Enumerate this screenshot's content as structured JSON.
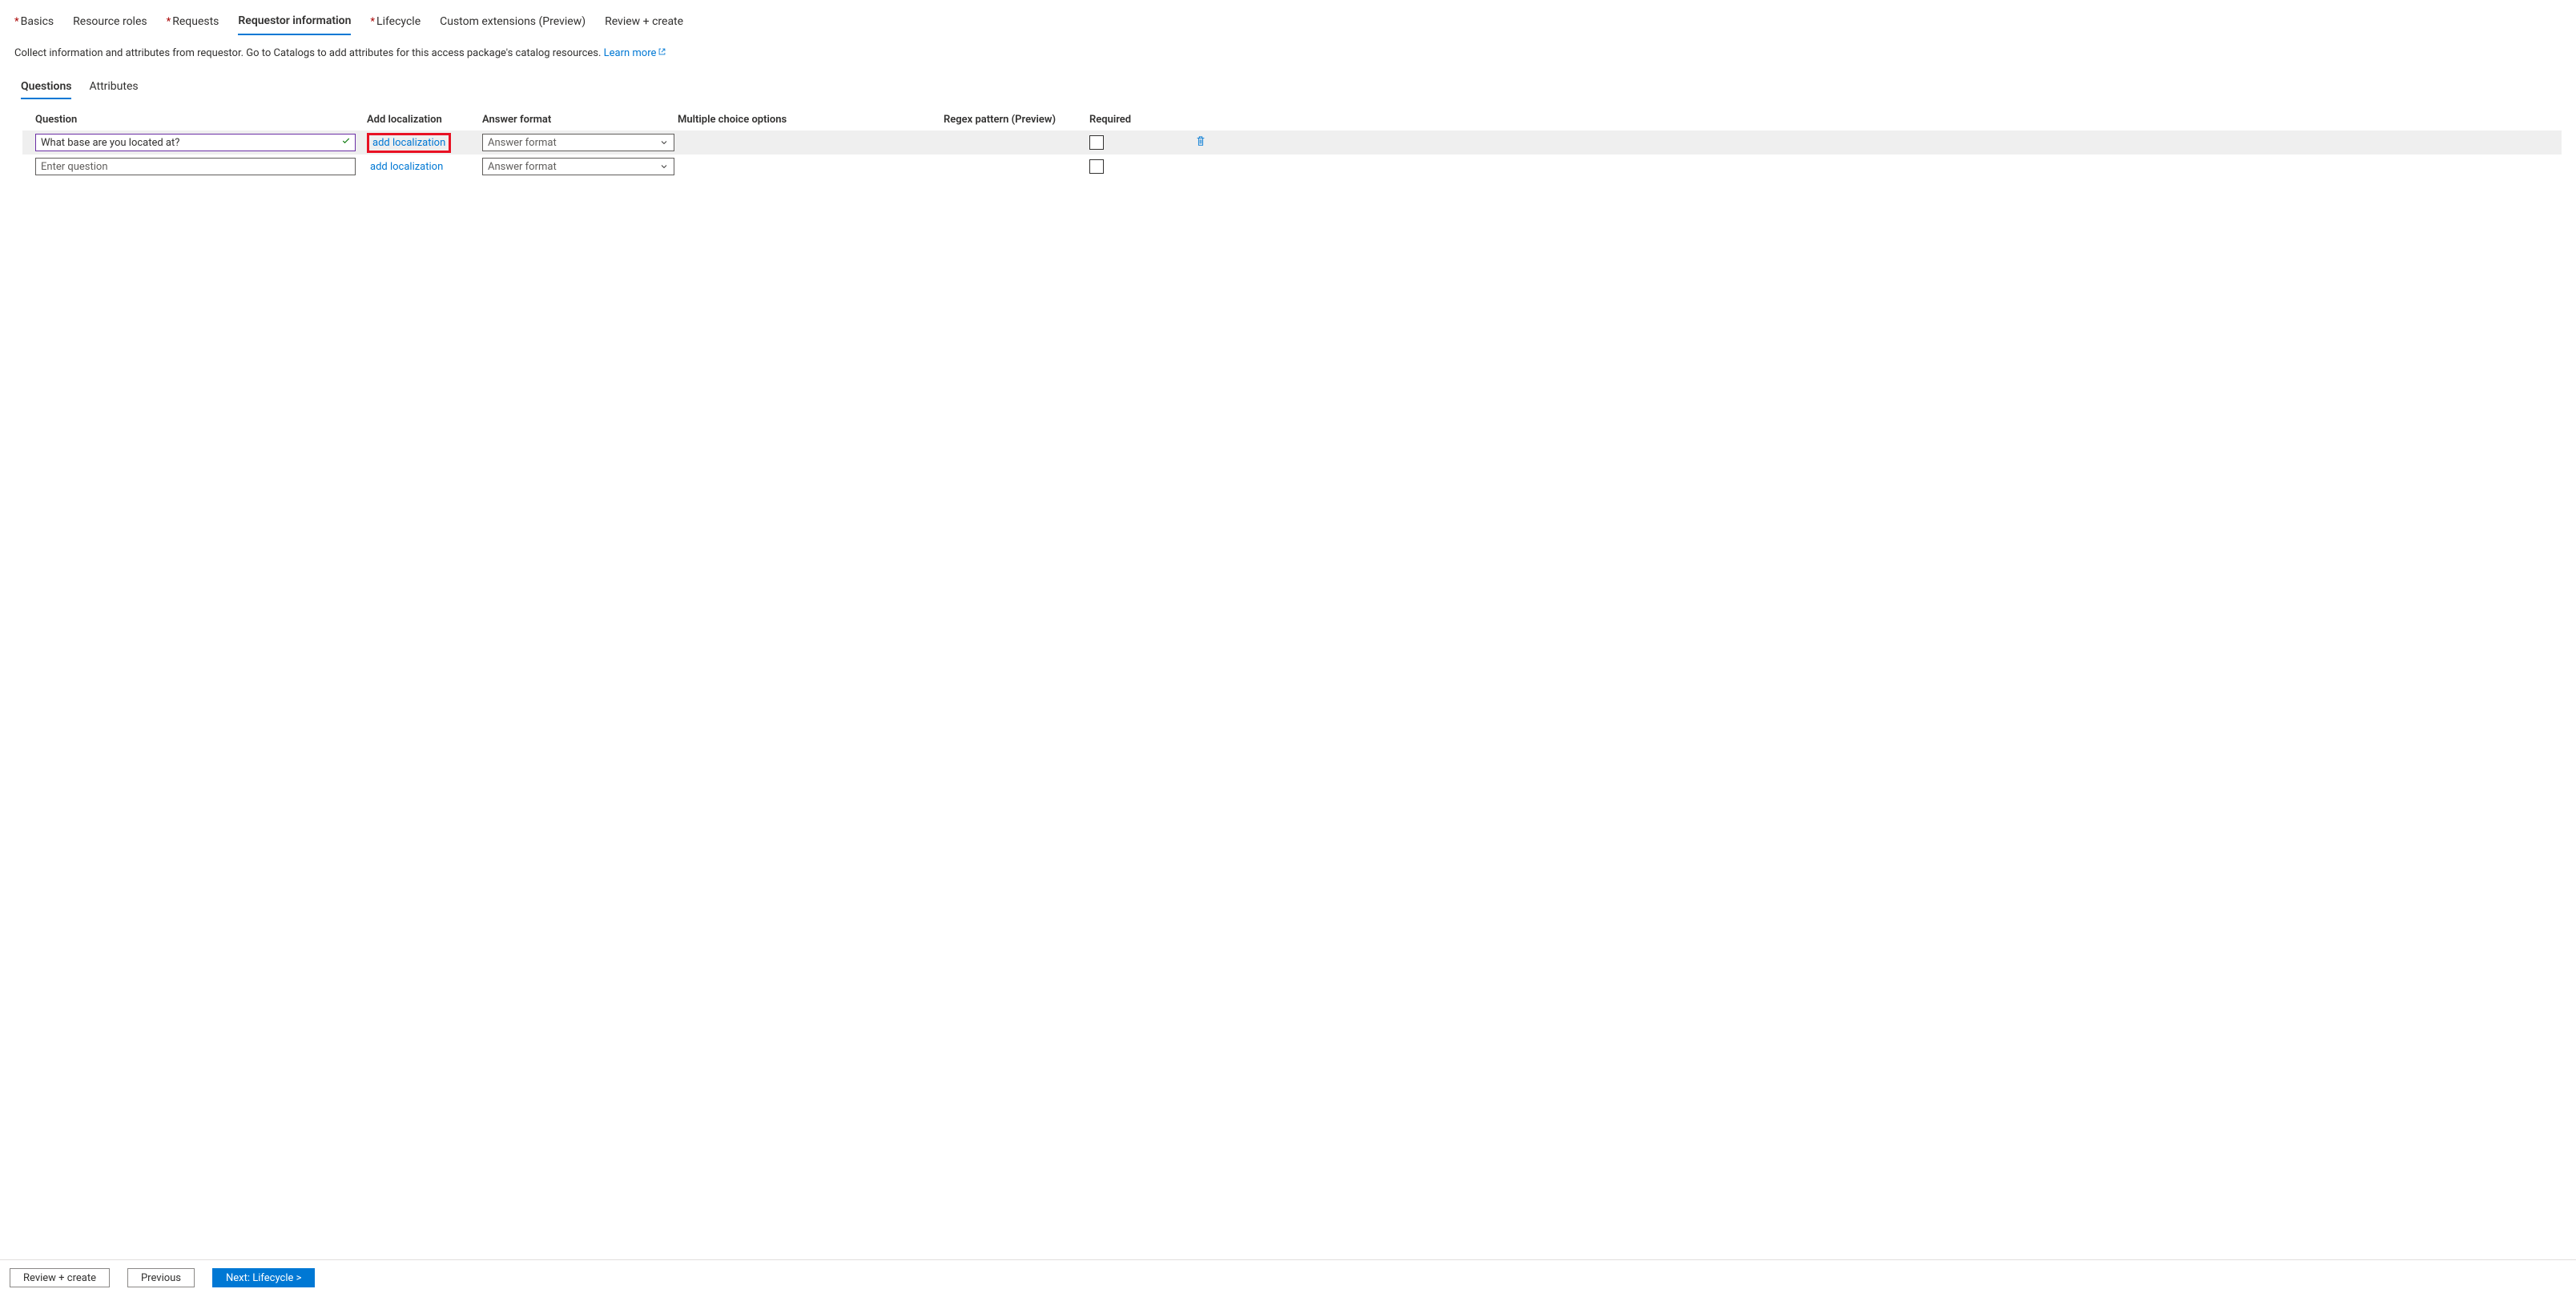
{
  "tabs": {
    "main": [
      {
        "label": "Basics",
        "required": true,
        "active": false
      },
      {
        "label": "Resource roles",
        "required": false,
        "active": false
      },
      {
        "label": "Requests",
        "required": true,
        "active": false
      },
      {
        "label": "Requestor information",
        "required": false,
        "active": true
      },
      {
        "label": "Lifecycle",
        "required": true,
        "active": false
      },
      {
        "label": "Custom extensions (Preview)",
        "required": false,
        "active": false
      },
      {
        "label": "Review + create",
        "required": false,
        "active": false
      }
    ]
  },
  "description": {
    "text": "Collect information and attributes from requestor. Go to Catalogs to add attributes for this access package's catalog resources. ",
    "link": "Learn more"
  },
  "subtabs": [
    {
      "label": "Questions",
      "active": true
    },
    {
      "label": "Attributes",
      "active": false
    }
  ],
  "columns": {
    "question": "Question",
    "addloc": "Add localization",
    "answerfmt": "Answer format",
    "multchoice": "Multiple choice options",
    "regex": "Regex pattern (Preview)",
    "required": "Required"
  },
  "rows": [
    {
      "value": "What base are you located at?",
      "placeholder": "Enter question",
      "valid": true,
      "addloc": "add localization",
      "addloc_highlight": true,
      "answerfmt": "Answer format",
      "has_delete": true
    },
    {
      "value": "",
      "placeholder": "Enter question",
      "valid": false,
      "addloc": "add localization",
      "addloc_highlight": false,
      "answerfmt": "Answer format",
      "has_delete": false
    }
  ],
  "footer": {
    "review": "Review + create",
    "previous": "Previous",
    "next": "Next: Lifecycle >"
  }
}
